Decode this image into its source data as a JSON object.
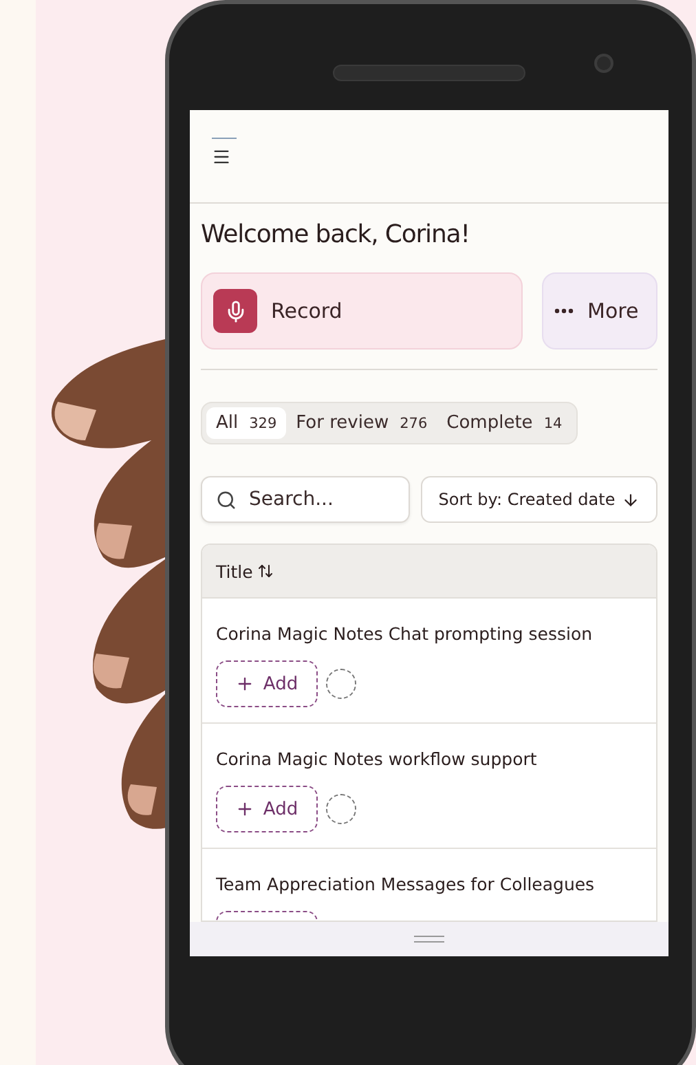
{
  "greeting": "Welcome back, Corina!",
  "actions": [
    {
      "kind": "record",
      "label": "Record"
    },
    {
      "kind": "more",
      "label": "More"
    }
  ],
  "tabs": [
    {
      "label": "All",
      "count": "329",
      "selected": true
    },
    {
      "label": "For review",
      "count": "276",
      "selected": false
    },
    {
      "label": "Complete",
      "count": "14",
      "selected": false
    }
  ],
  "search": {
    "placeholder": "Search..."
  },
  "sort": {
    "label": "Sort by: Created date"
  },
  "table": {
    "header": "Title",
    "rows": [
      {
        "title": "Corina Magic Notes Chat prompting session",
        "add_label": "Add",
        "complete": false
      },
      {
        "title": "Corina Magic Notes workflow support",
        "add_label": "Add",
        "complete": false
      },
      {
        "title": "Team Appreciation Messages for Colleagues"
      }
    ]
  }
}
